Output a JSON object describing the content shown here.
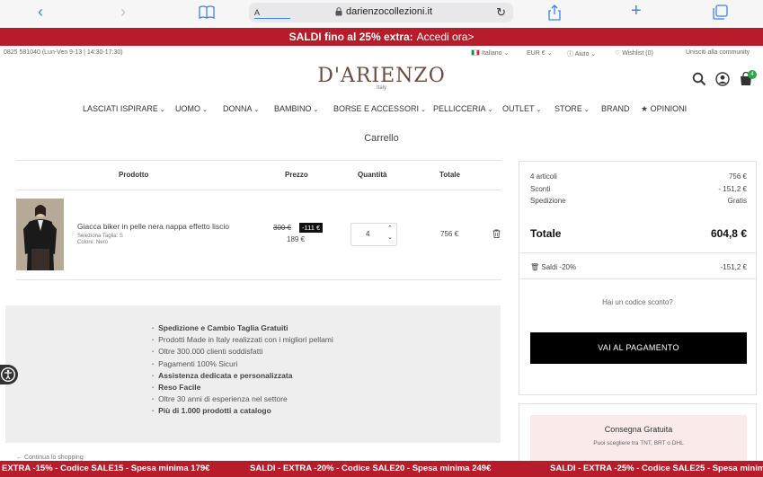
{
  "browser": {
    "url": "darienzocollezioni.it",
    "text_size_label": "A"
  },
  "promo_top": {
    "text": "SALDI fino al 25% extra:",
    "cta": "Accedi ora>"
  },
  "util": {
    "phone": "0825 581040 (Lun-Ven 9-13 | 14:30-17:30)",
    "language": "Italiano",
    "currency": "EUR €",
    "help": "Aiuto",
    "wishlist": "Wishlist (0)",
    "community": "Unisciti alla community"
  },
  "brand": {
    "name": "D'ARIENZO",
    "sub": "Italy"
  },
  "cart_badge": "4",
  "nav": {
    "items": [
      "LASCIATI ISPIRARE",
      "UOMO",
      "DONNA",
      "BAMBINO",
      "BORSE E ACCESSORI",
      "PELLICCERIA",
      "OUTLET",
      "STORE",
      "BRAND",
      "OPINIONI"
    ]
  },
  "page_title": "Carrello",
  "table": {
    "headers": [
      "Prodotto",
      "Prezzo",
      "Quantità",
      "Totale"
    ]
  },
  "item": {
    "name": "Giacca biker in pelle nera nappa effetto liscio",
    "size": "Seleziona Taglia: S",
    "color": "Colore: Nero",
    "price_old": "300 €",
    "discount": "-111 €",
    "price_now": "189 €",
    "qty": "4",
    "total": "756 €"
  },
  "perks": [
    {
      "text": "Spedizione e Cambio Taglia Gratuiti",
      "bold": true
    },
    {
      "text": "Prodotti Made in Italy realizzati con i migliori pellami",
      "bold": false
    },
    {
      "text": "Oltre 300.000 clienti soddisfatti",
      "bold": false
    },
    {
      "text": "Pagamenti 100% Sicuri",
      "bold": false
    },
    {
      "text": "Assistenza dedicata e personalizzata",
      "bold": true
    },
    {
      "text": "Reso Facile",
      "bold": true
    },
    {
      "text": "Oltre 30 anni di esperienza nel settore",
      "bold": false
    },
    {
      "text": "Più di 1.000 prodotti a catalogo",
      "bold": true
    }
  ],
  "back_link": "← Continua lo shopping",
  "summary": {
    "articles_label": "4 articoli",
    "articles_value": "756 €",
    "discount_label": "Sconti",
    "discount_value": "- 151,2 €",
    "shipping_label": "Spedizione",
    "shipping_value": "Gratis",
    "total_label": "Totale",
    "total_value": "604,8 €",
    "sale_label": "Saldi -20%",
    "sale_value": "-151,2 €",
    "coupon": "Hai un codice sconto?",
    "pay_button": "VAI AL PAGAMENTO"
  },
  "shipping_box": {
    "title": "Consegna Gratuita",
    "subtitle": "Puoi scegliere tra TNT, BRT o DHL"
  },
  "promo_bottom": [
    "EXTRA -15% - Codice SALE15 - Spesa minima 179€",
    "SALDI - EXTRA -20% - Codice SALE20 - Spesa minima 249€",
    "SALDI - EXTRA -25% - Codice SALE25 - Spesa minima 3"
  ],
  "colors": {
    "promo": "#b71c2a",
    "brand": "#6b4b3e",
    "badge": "#2aa84a",
    "button": "#000000"
  }
}
